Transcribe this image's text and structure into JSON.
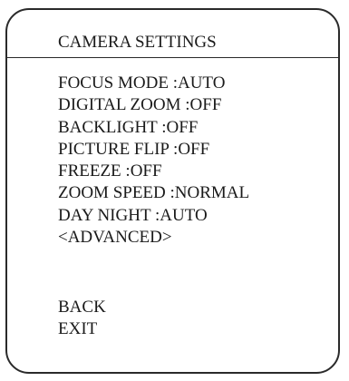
{
  "menu": {
    "title": "CAMERA SETTINGS",
    "items": [
      {
        "label": "FOCUS MODE",
        "value": "AUTO"
      },
      {
        "label": "DIGITAL ZOOM",
        "value": "OFF"
      },
      {
        "label": "BACKLIGHT",
        "value": "OFF"
      },
      {
        "label": "PICTURE FLIP",
        "value": "OFF"
      },
      {
        "label": "FREEZE",
        "value": "OFF"
      },
      {
        "label": "ZOOM SPEED",
        "value": "NORMAL"
      },
      {
        "label": "DAY NIGHT",
        "value": "AUTO"
      }
    ],
    "advanced_label": "<ADVANCED>",
    "back_label": "BACK",
    "exit_label": "EXIT"
  },
  "colors": {
    "text": "#1a1a1a",
    "border": "#2a2a2a",
    "background": "#ffffff"
  }
}
